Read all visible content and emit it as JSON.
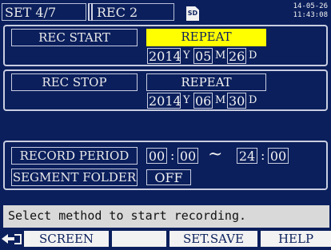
{
  "topbar": {
    "tab_set": "SET 4/7",
    "tab_rec": "REC 2",
    "sd_icon": "sd-card-icon",
    "sd_label": "SD",
    "date": "14-05-26",
    "time": "11:43:08"
  },
  "rec_start": {
    "label": "REC START",
    "mode": "REPEAT",
    "year": "2014",
    "year_unit": "Y",
    "month": "05",
    "month_unit": "M",
    "day": "26",
    "day_unit": "D"
  },
  "rec_stop": {
    "label": "REC STOP",
    "mode": "REPEAT",
    "year": "2014",
    "year_unit": "Y",
    "month": "06",
    "month_unit": "M",
    "day": "30",
    "day_unit": "D"
  },
  "record_period": {
    "label": "RECORD PERIOD",
    "start_hour": "00",
    "start_min": "00",
    "separator": "~",
    "end_hour": "24",
    "end_min": "00",
    "colon": ":"
  },
  "segment_folder": {
    "label": "SEGMENT FOLDER",
    "value": "OFF"
  },
  "status_message": "Select method to start recording.",
  "function_keys": {
    "f1_icon": "arrow-exit-icon",
    "f1": "SCREEN",
    "f2": "",
    "f3": "SET.SAVE",
    "f4": "HELP"
  },
  "colors": {
    "background": "#0b1f5c",
    "highlight": "#ffff00",
    "status_bar": "#d9d9d9"
  }
}
